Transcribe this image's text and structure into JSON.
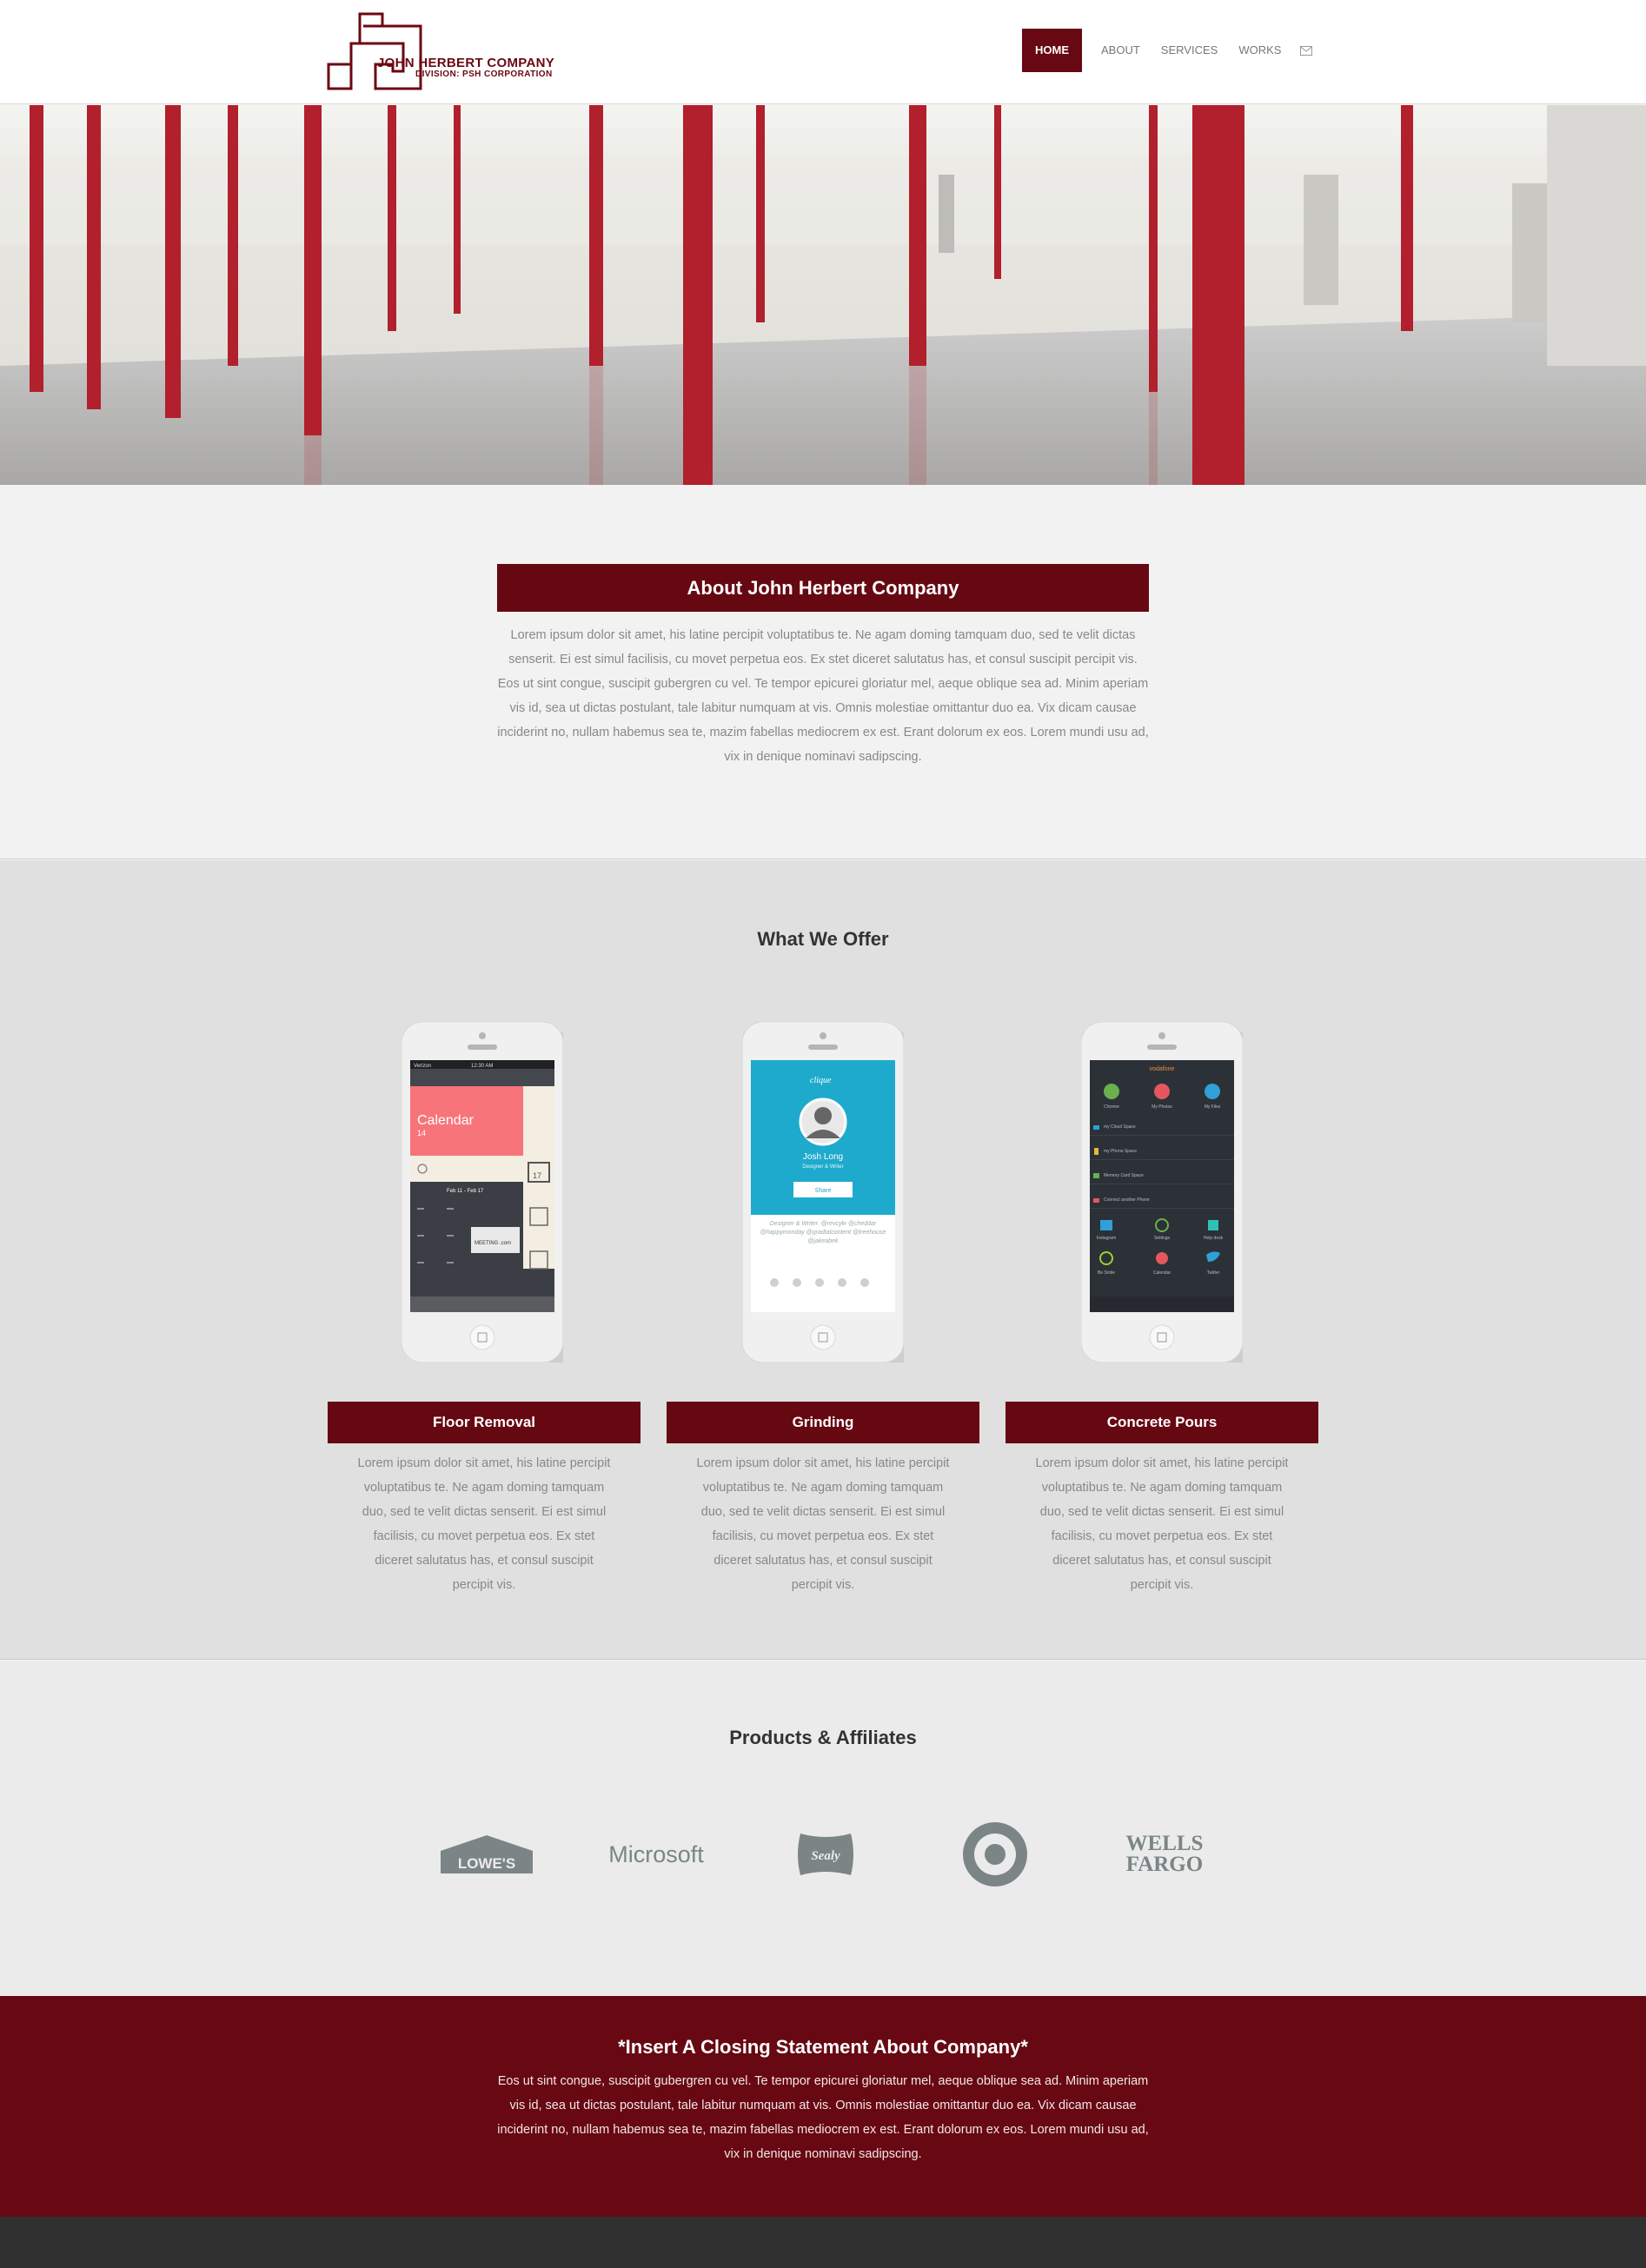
{
  "brand": {
    "name": "JOHN HERBERT COMPANY",
    "subtitle": "DIVISION: PSH CORPORATION"
  },
  "nav": {
    "items": [
      "HOME",
      "ABOUT",
      "SERVICES",
      "WORKS"
    ],
    "active": "HOME",
    "mail_icon": "envelope-icon"
  },
  "about": {
    "title": "About John Herbert Company",
    "text": "Lorem ipsum dolor sit amet, his latine percipit voluptatibus te. Ne agam doming tamquam duo, sed te velit dictas senserit. Ei est simul facilisis, cu movet perpetua eos. Ex stet diceret salutatus has, et consul suscipit percipit vis. Eos ut sint congue, suscipit gubergren cu vel. Te tempor epicurei gloriatur mel, aeque oblique sea ad. Minim aperiam vis id, sea ut dictas postulant, tale labitur numquam at vis. Omnis molestiae omittantur duo ea. Vix dicam causae inciderint no, nullam habemus sea te, mazim fabellas mediocrem ex est. Erant dolorum ex eos. Lorem mundi usu ad, vix in denique nominavi sadipscing."
  },
  "offer": {
    "title": "What We Offer",
    "cards": [
      {
        "title": "Floor Removal",
        "text": "Lorem ipsum dolor sit amet, his latine percipit voluptatibus te. Ne agam doming tamquam duo, sed te velit dictas senserit. Ei est simul facilisis, cu movet perpetua eos. Ex stet diceret salutatus has, et consul suscipit percipit vis.",
        "screen": {
          "carrier": "Verizon",
          "time": "12:30 AM",
          "heading": "Calendar",
          "date": "14",
          "week": "Feb 11 - Feb 17",
          "event": "MEETING .com",
          "day": "17"
        }
      },
      {
        "title": "Grinding",
        "text": "Lorem ipsum dolor sit amet, his latine percipit voluptatibus te. Ne agam doming tamquam duo, sed te velit dictas senserit. Ei est simul facilisis, cu movet perpetua eos. Ex stet diceret salutatus has, et consul suscipit percipit vis.",
        "screen": {
          "app": "clique",
          "name": "Josh Long",
          "role": "Designer & Writer",
          "button": "Share",
          "bio": "Designer & Writer. @revcyle @cheddar @happymonday @gradtalcontent @treehouse @jakeabek"
        }
      },
      {
        "title": "Concrete Pours",
        "text": "Lorem ipsum dolor sit amet, his latine percipit voluptatibus te. Ne agam doming tamquam duo, sed te velit dictas senserit. Ei est simul facilisis, cu movet perpetua eos. Ex stet diceret salutatus has, et consul suscipit percipit vis.",
        "screen": {
          "carrier": "vodafone",
          "row1": [
            "Chrome",
            "My Photos",
            "My Files"
          ],
          "list": [
            "my Cloud Space",
            "my Phone Space",
            "Memory Card Space",
            "Connect another Phone"
          ],
          "row2": [
            "Instagram",
            "Settings",
            "Help desk"
          ],
          "row3": [
            "Be Smile",
            "Calendar",
            "Twitter"
          ]
        }
      }
    ]
  },
  "products": {
    "title": "Products & Affiliates",
    "logos": [
      "LOWE'S",
      "Microsoft",
      "Sealy",
      "target-logo",
      "WELLS FARGO"
    ]
  },
  "closing": {
    "title": "*Insert A Closing Statement About Company*",
    "text": "Eos ut sint congue, suscipit gubergren cu vel. Te tempor epicurei gloriatur mel, aeque oblique sea ad. Minim aperiam vis id, sea ut dictas postulant, tale labitur numquam at vis. Omnis molestiae omittantur duo ea. Vix dicam causae inciderint no, nullam habemus sea te, mazim fabellas mediocrem ex est. Erant dolorum ex eos. Lorem mundi usu ad, vix in denique nominavi sadipscing."
  },
  "colors": {
    "brand": "#670812",
    "footer": "#303030",
    "section_light": "#f2f2f2",
    "section_gray": "#e0e0e0",
    "logo_gray": "#7b8586"
  }
}
